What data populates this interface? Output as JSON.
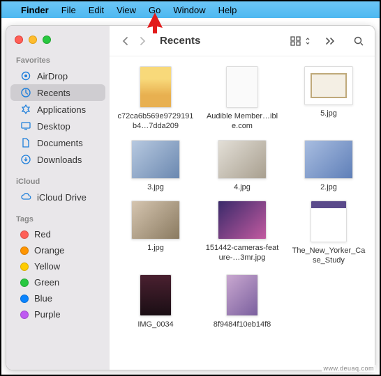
{
  "menubar": {
    "apple": "",
    "app": "Finder",
    "items": [
      "File",
      "Edit",
      "View",
      "Go",
      "Window",
      "Help"
    ]
  },
  "sidebar": {
    "favorites": {
      "heading": "Favorites",
      "items": [
        {
          "icon": "airdrop",
          "label": "AirDrop"
        },
        {
          "icon": "recents",
          "label": "Recents",
          "active": true
        },
        {
          "icon": "apps",
          "label": "Applications"
        },
        {
          "icon": "desktop",
          "label": "Desktop"
        },
        {
          "icon": "documents",
          "label": "Documents"
        },
        {
          "icon": "downloads",
          "label": "Downloads"
        }
      ]
    },
    "icloud": {
      "heading": "iCloud",
      "items": [
        {
          "icon": "cloud",
          "label": "iCloud Drive"
        }
      ]
    },
    "tags": {
      "heading": "Tags",
      "items": [
        {
          "color": "#ff5f57",
          "label": "Red"
        },
        {
          "color": "#ff9500",
          "label": "Orange"
        },
        {
          "color": "#ffcc00",
          "label": "Yellow"
        },
        {
          "color": "#28c840",
          "label": "Green"
        },
        {
          "color": "#0a84ff",
          "label": "Blue"
        },
        {
          "color": "#bf5af2",
          "label": "Purple"
        }
      ]
    }
  },
  "toolbar": {
    "title": "Recents"
  },
  "files": [
    {
      "label": "c72ca6b569e9729191b4…7dda209",
      "thumb": "tall",
      "art": "pooh"
    },
    {
      "label": "Audible Member…ible.com",
      "thumb": "tall",
      "art": "white"
    },
    {
      "label": "5.jpg",
      "thumb": "wide",
      "art": "frame"
    },
    {
      "label": "3.jpg",
      "thumb": "wide",
      "art": "photo1"
    },
    {
      "label": "4.jpg",
      "thumb": "wide",
      "art": "photo2"
    },
    {
      "label": "2.jpg",
      "thumb": "wide",
      "art": "photo4"
    },
    {
      "label": "1.jpg",
      "thumb": "wide",
      "art": "photo3"
    },
    {
      "label": "151442-cameras-feature-…3mr.jpg",
      "thumb": "wide",
      "art": "photo5"
    },
    {
      "label": "The_New_Yorker_Case_Study",
      "thumb": "doc",
      "art": "docpage"
    },
    {
      "label": "IMG_0034",
      "thumb": "tall",
      "art": "photo6"
    },
    {
      "label": "8f9484f10eb14f8",
      "thumb": "tall",
      "art": "photo7"
    }
  ],
  "watermark": "www.deuaq.com"
}
